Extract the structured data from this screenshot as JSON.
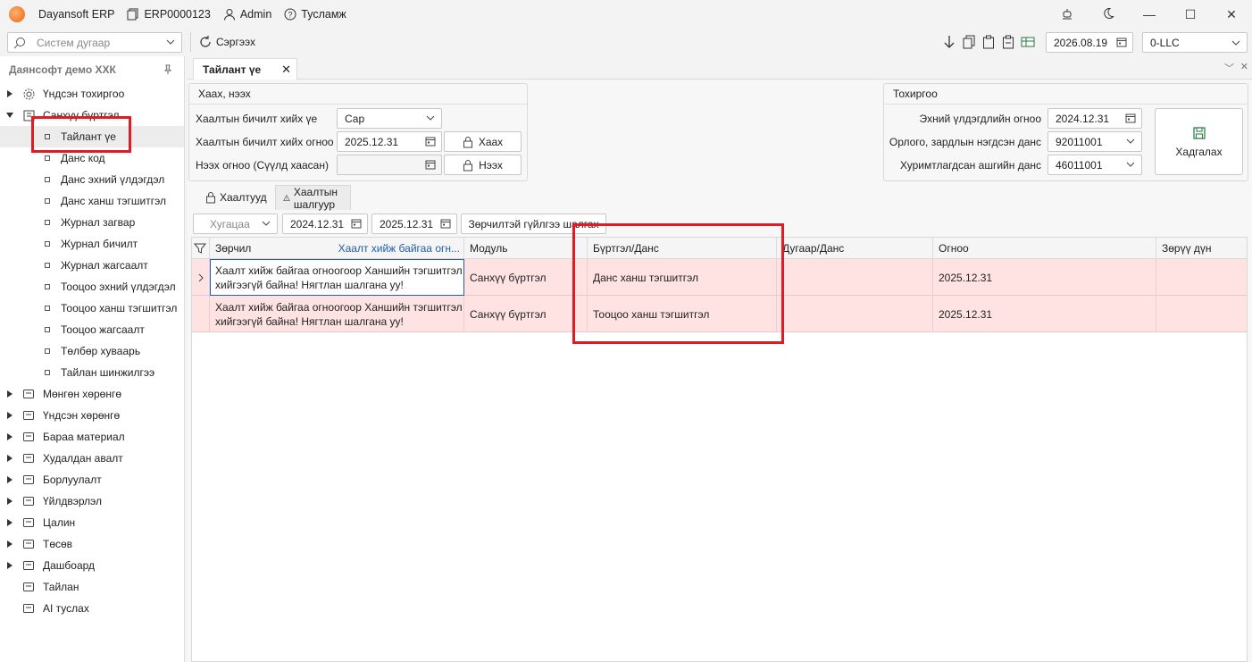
{
  "titlebar": {
    "app_name": "Dayansoft ERP",
    "erp_code": "ERP0000123",
    "user": "Admin",
    "help": "Тусламж"
  },
  "toolbar": {
    "system_search_placeholder": "Систем дугаар",
    "refresh_label": "Сэргээх",
    "current_date": "2026.08.19",
    "company": "0-LLC"
  },
  "sidebar": {
    "org_name": "Даянсофт демо ХХК",
    "items": [
      {
        "label": "Үндсэн тохиргоо",
        "icon": "gear-icon"
      },
      {
        "label": "Санхүү бүртгэл",
        "icon": "ledger-icon"
      }
    ],
    "sub_items": [
      "Тайлант үе",
      "Данс код",
      "Данс эхний үлдэгдэл",
      "Данс ханш тэгшитгэл",
      "Журнал загвар",
      "Журнал бичилт",
      "Журнал жагсаалт",
      "Тооцоо эхний үлдэгдэл",
      "Тооцоо ханш тэгшитгэл",
      "Тооцоо жагсаалт",
      "Төлбөр хуваарь",
      "Тайлан шинжилгээ"
    ],
    "modules": [
      "Мөнгөн хөрөнгө",
      "Үндсэн хөрөнгө",
      "Бараа материал",
      "Худалдан авалт",
      "Борлуулалт",
      "Үйлдвэрлэл",
      "Цалин",
      "Төсөв",
      "Дашбоард",
      "Тайлан",
      "AI туслах"
    ]
  },
  "document_tab": {
    "label": "Тайлант үе"
  },
  "close_open_group": {
    "title": "Хаах, нээх",
    "period_label": "Хаалтын бичилт хийх үе",
    "period_value": "Сар",
    "date_label": "Хаалтын бичилт хийх огноо",
    "date_value": "2025.12.31",
    "open_label": "Нээх огноо (Сүүлд хаасан)",
    "open_value": "",
    "close_button": "Хаах",
    "open_button": "Нээх"
  },
  "settings_group": {
    "title": "Тохиргоо",
    "initial_balance_label": "Эхний үлдэгдлийн огноо",
    "initial_balance_value": "2024.12.31",
    "income_account_label": "Орлого, зардлын нэгдсэн данс",
    "income_account_value": "92011001",
    "retained_label": "Хуримтлагдсан ашгийн данс",
    "retained_value": "46011001",
    "save_button": "Хадгалах"
  },
  "sub_tabs": [
    "Хаалтууд",
    "Хаалтын шалгуур"
  ],
  "filters": {
    "period_placeholder": "Хугацаа",
    "date_from": "2024.12.31",
    "date_to": "2025.12.31",
    "error_button": "Зөрчилтэй гүйлгээ шалгах"
  },
  "grid": {
    "columns": [
      "Зөрчил",
      "Хаалт хийж байгаа огн...",
      "Модуль",
      "Бүртгэл/Данс",
      "Дугаар/Данс",
      "Огноо",
      "Зөрүү дүн"
    ],
    "rows": [
      {
        "issue": "Хаалт хийж байгаа огноогоор Ханшийн тэгшитгэл хийгээгүй байна! Нягтлан шалгана уу!",
        "module": "Санхүү бүртгэл",
        "register": "Данс ханш тэгшитгэл",
        "number": "",
        "date": "2025.12.31",
        "diff": ""
      },
      {
        "issue": "Хаалт хийж байгаа огноогоор Ханшийн тэгшитгэл хийгээгүй байна! Нягтлан шалгана уу!",
        "module": "Санхүү бүртгэл",
        "register": "Тооцоо ханш тэгшитгэл",
        "number": "",
        "date": "2025.12.31",
        "diff": ""
      }
    ]
  },
  "colors": {
    "row_error": "#ffe3e3",
    "highlight": "#e01b24",
    "link": "#1f5fa8"
  }
}
